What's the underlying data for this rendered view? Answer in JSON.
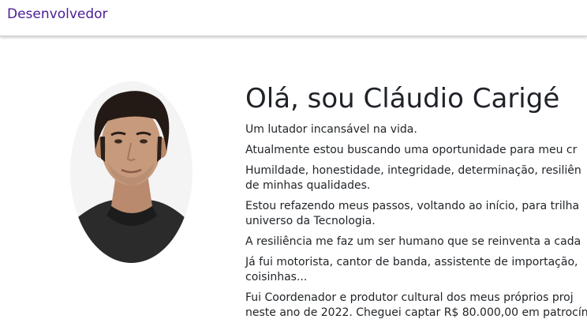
{
  "navbar": {
    "brand_label": "Desenvolvedor",
    "brand_color": "#4b1d96"
  },
  "profile": {
    "photo_alt": "Foto de Cláudio Carigé",
    "heading": "Olá, sou Cláudio Carigé",
    "paragraphs": [
      {
        "lines": [
          "Um lutador incansável na vida."
        ]
      },
      {
        "lines": [
          "Atualmente estou buscando uma oportunidade para meu cr"
        ]
      },
      {
        "lines": [
          "Humildade, honestidade, integridade, determinação, resiliên",
          "de minhas qualidades."
        ]
      },
      {
        "lines": [
          "Estou refazendo meus passos, voltando ao início, para trilha",
          "universo da Tecnologia."
        ]
      },
      {
        "lines": [
          "A resiliência me faz um ser humano que se reinventa a cada"
        ]
      },
      {
        "lines": [
          "Já fui motorista, cantor de banda, assistente de importação,",
          "coisinhas..."
        ]
      },
      {
        "lines": [
          "Fui Coordenador e produtor cultural dos meus próprios proj",
          "neste ano de 2022. Cheguei captar R$ 80.000,00 em patrocín"
        ]
      }
    ]
  }
}
